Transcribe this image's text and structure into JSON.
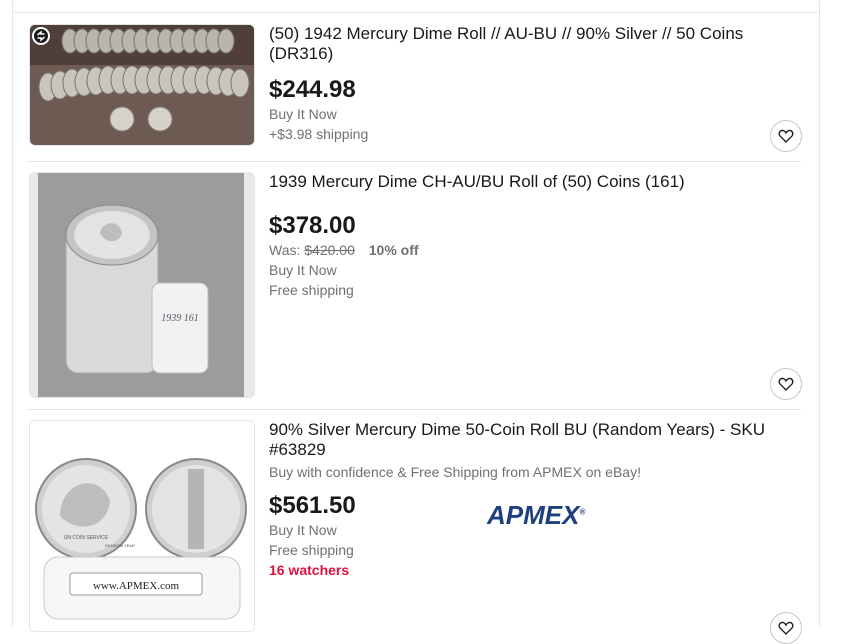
{
  "listings": [
    {
      "title": "(50) 1942 Mercury Dime Roll // AU-BU // 90% Silver // 50 Coins (DR316)",
      "price": "$244.98",
      "format": "Buy It Now",
      "shipping": "+$3.98 shipping",
      "thumb_icon": "coin-roll-image",
      "badge_icon": "refresh-badge-icon"
    },
    {
      "title": "1939 Mercury Dime CH-AU/BU Roll of (50) Coins (161)",
      "price": "$378.00",
      "was_label": "Was:",
      "was_price": "$420.00",
      "discount": "10% off",
      "format": "Buy It Now",
      "shipping": "Free shipping",
      "thumb_icon": "coin-tube-image",
      "tube_label": "1939 161"
    },
    {
      "title": "90% Silver Mercury Dime 50-Coin Roll BU (Random Years) - SKU #63829",
      "promo": "Buy with confidence & Free Shipping from APMEX on eBay!",
      "price": "$561.50",
      "format": "Buy It Now",
      "shipping": "Free shipping",
      "watchers": "16 watchers",
      "brand_logo": "APMEX",
      "tube_label": "www.APMEX.com",
      "coin_text_1": "UN COIN SERVICE",
      "coin_text_2": "RANDOM YEAR"
    }
  ],
  "colors": {
    "price": "#191919",
    "secondary": "#707070",
    "watchers": "#e0103a",
    "brand": "#1f3f7f"
  }
}
